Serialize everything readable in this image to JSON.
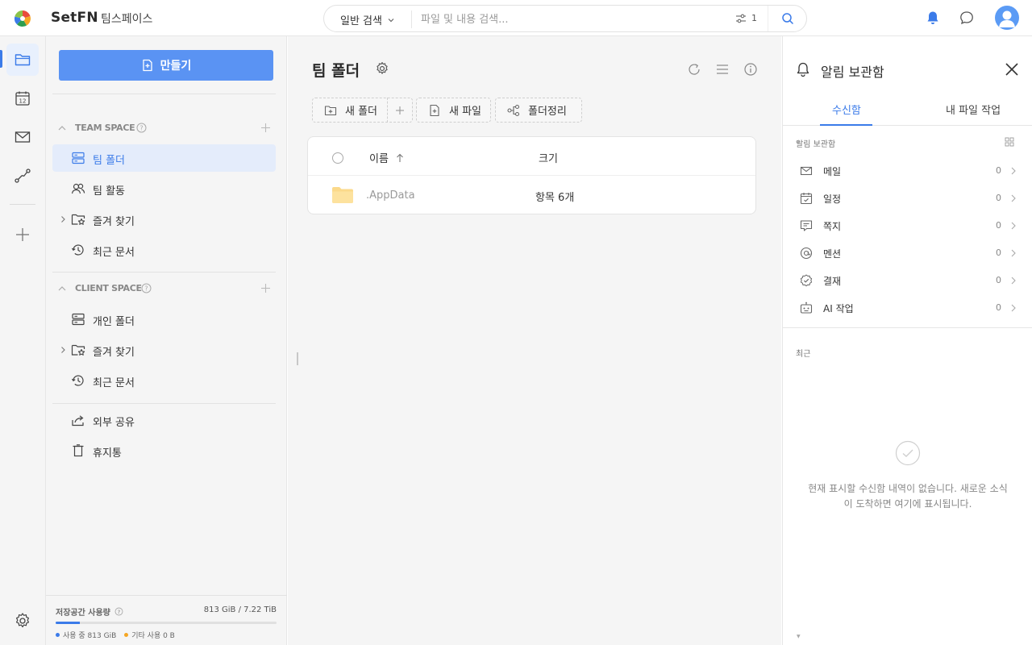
{
  "topbar": {
    "brand": "SetFN",
    "workspace": "팀스페이스",
    "search_mode": "일반 검색",
    "search_placeholder": "파일 및 내용 검색...",
    "filter_count": "1"
  },
  "sidebar": {
    "create_label": "만들기",
    "team_space": {
      "label": "TEAM SPACE",
      "items": [
        {
          "label": "팀 폴더",
          "icon": "server-icon",
          "active": true
        },
        {
          "label": "팀 활동",
          "icon": "users-icon"
        },
        {
          "label": "즐겨 찾기",
          "icon": "folder-star-icon",
          "expandable": true
        },
        {
          "label": "최근 문서",
          "icon": "history-icon"
        }
      ]
    },
    "client_space": {
      "label": "CLIENT SPACE",
      "items": [
        {
          "label": "개인 폴더",
          "icon": "server-icon"
        },
        {
          "label": "즐겨 찾기",
          "icon": "folder-star-icon",
          "expandable": true
        },
        {
          "label": "최근 문서",
          "icon": "history-icon"
        }
      ]
    },
    "bottom_items": [
      {
        "label": "외부 공유",
        "icon": "share-icon"
      },
      {
        "label": "휴지통",
        "icon": "trash-icon"
      }
    ],
    "storage": {
      "title": "저장공간 사용량",
      "amount": "813 GiB / 7.22 TiB",
      "used_fraction": 0.11,
      "legend_used": "사용 중 813 GiB",
      "legend_other": "기타 사용 0 B",
      "color_used": "#3b7be9",
      "color_other": "#f5a623"
    }
  },
  "main": {
    "title": "팀 폴더",
    "toolbar": {
      "new_folder": "새 폴더",
      "new_file": "새 파일",
      "organize": "폴더정리"
    },
    "table": {
      "col_name": "이름",
      "col_size": "크기",
      "rows": [
        {
          "name": ".AppData",
          "size": "항목 6개"
        }
      ]
    }
  },
  "panel": {
    "title": "알림 보관함",
    "tabs": [
      "수신함",
      "내 파일 작업"
    ],
    "section_label": "알림 보관함",
    "items": [
      {
        "label": "메일",
        "count": "0",
        "icon": "mail-icon"
      },
      {
        "label": "일정",
        "count": "0",
        "icon": "calendar-icon"
      },
      {
        "label": "쪽지",
        "count": "0",
        "icon": "note-icon"
      },
      {
        "label": "멘션",
        "count": "0",
        "icon": "at-icon"
      },
      {
        "label": "결재",
        "count": "0",
        "icon": "approval-icon"
      },
      {
        "label": "AI 작업",
        "count": "0",
        "icon": "ai-icon"
      }
    ],
    "recent_label": "최근",
    "empty_text": "현재 표시할 수신함 내역이 없습니다. 새로운 소식이 도착하면 여기에 표시됩니다."
  },
  "colors": {
    "accent": "#3b7be9",
    "create_button": "#5a93f3",
    "folder": "#fbd98a"
  }
}
